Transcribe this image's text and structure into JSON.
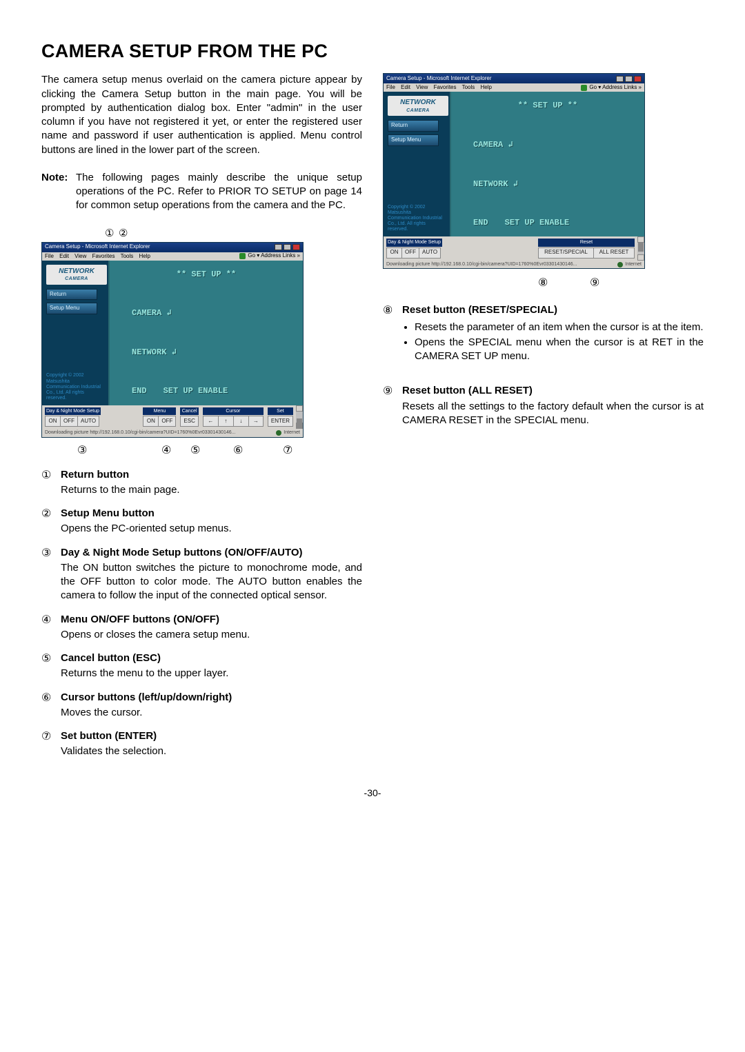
{
  "title": "CAMERA SETUP FROM THE PC",
  "intro": "The camera setup menus overlaid on the camera picture appear by clicking the Camera Setup button in the main page. You will be prompted by authentication dialog box. Enter \"admin\" in the user column if you have not registered it yet, or enter the registered user name and password if user authentication is applied. Menu control buttons are lined in the lower part of the screen.",
  "note_label": "Note:",
  "note_body": "The following pages mainly describe the unique setup operations of the PC. Refer to PRIOR TO SETUP on page 14 for common setup operations from the camera and the PC.",
  "callouts_top": [
    "①",
    "②"
  ],
  "callouts_bottom_left": [
    "③",
    "④",
    "⑤",
    "⑥",
    "⑦"
  ],
  "callouts_bottom_right": [
    "⑧",
    "⑨"
  ],
  "ie": {
    "title": "Camera Setup - Microsoft Internet Explorer",
    "menu": [
      "File",
      "Edit",
      "View",
      "Favorites",
      "Tools",
      "Help"
    ],
    "addr_right": "Go  ▾   Address   Links »",
    "brand_line1": "NETWORK",
    "brand_line2": "CAMERA",
    "side_return": "Return",
    "side_setup": "Setup Menu",
    "copyright": "Copyright © 2002 Matsushita Communication Industrial Co., Ltd. All rights reserved.",
    "osd_title": "** SET UP **",
    "osd_camera": "CAMERA ↲",
    "osd_network": "NETWORK ↲",
    "osd_end": "END",
    "osd_enable": "SET UP ENABLE",
    "grp_daynight": "Day & Night Mode Setup",
    "btn_on": "ON",
    "btn_off": "OFF",
    "btn_auto": "AUTO",
    "grp_menu": "Menu",
    "grp_cancel": "Cancel",
    "btn_esc": "ESC",
    "grp_cursor": "Cursor",
    "grp_set": "Set",
    "btn_enter": "ENTER",
    "grp_reset": "Reset",
    "btn_reset_special": "RESET/SPECIAL",
    "btn_all_reset": "ALL RESET",
    "status_left": "Downloading picture http://192.168.0.10/cgi-bin/camera?UID=1760%0Evr03301430146...",
    "status_right": "Internet"
  },
  "items_left": [
    {
      "num": "①",
      "head": "Return button",
      "body": "Returns to the main page."
    },
    {
      "num": "②",
      "head": "Setup Menu button",
      "body": "Opens the PC-oriented setup menus."
    },
    {
      "num": "③",
      "head": "Day & Night Mode Setup buttons (ON/OFF/AUTO)",
      "body": "The ON button switches the picture to monochrome mode, and the OFF button to color mode. The AUTO button enables the camera to follow the input of the connected optical sensor."
    },
    {
      "num": "④",
      "head": "Menu ON/OFF buttons (ON/OFF)",
      "body": "Opens or closes the camera setup menu."
    },
    {
      "num": "⑤",
      "head": "Cancel button (ESC)",
      "body": "Returns the menu to the upper layer."
    },
    {
      "num": "⑥",
      "head": "Cursor buttons (left/up/down/right)",
      "body": "Moves the cursor."
    },
    {
      "num": "⑦",
      "head": "Set button (ENTER)",
      "body": "Validates the selection."
    }
  ],
  "items_right": [
    {
      "num": "⑧",
      "head": "Reset button (RESET/SPECIAL)",
      "bullets": [
        "Resets the parameter of an item when the cursor is at the item.",
        "Opens the SPECIAL menu when the cursor is at RET in the CAMERA SET UP menu."
      ]
    },
    {
      "num": "⑨",
      "head": "Reset button (ALL RESET)",
      "body": "Resets all the settings to the factory default when the cursor is at CAMERA RESET in the SPECIAL menu."
    }
  ],
  "page_number": "-30-"
}
